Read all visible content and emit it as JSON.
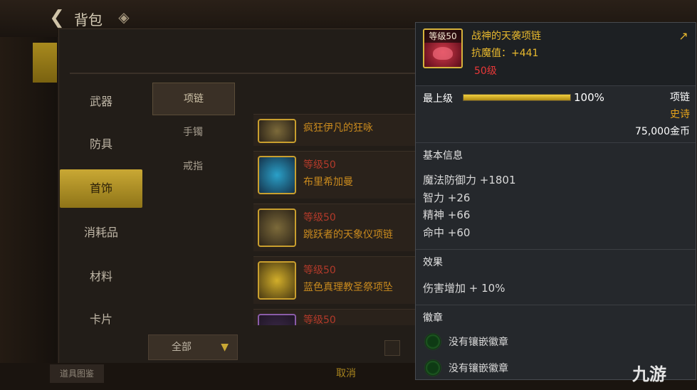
{
  "header": {
    "title": "背包",
    "back_icon": "back-arrow-icon",
    "diamond_icon": "diamond-icon"
  },
  "categories": [
    "武器",
    "防具",
    "首饰",
    "消耗品",
    "材料",
    "卡片"
  ],
  "active_category": "首饰",
  "subcategories": [
    "项链",
    "手镯",
    "戒指"
  ],
  "active_subcategory": "项链",
  "items": [
    {
      "level": "",
      "name": "疯狂伊凡的狂咏"
    },
    {
      "level": "等级50",
      "name": "布里希加曼"
    },
    {
      "level": "等级50",
      "name": "跳跃者的天象仪项链"
    },
    {
      "level": "等级50",
      "name": "蓝色真理教圣祭项坠"
    },
    {
      "level": "等级50",
      "name": ""
    }
  ],
  "filter": {
    "label": "全部",
    "arrow": "▼"
  },
  "bottom": {
    "left_label": "道具图鉴",
    "mid_label": "取消"
  },
  "tooltip": {
    "icon_level": "等级50",
    "name": "战神的天袭项链",
    "resist": "抗魔值：+441",
    "level_req": "50级",
    "grade": "最上级",
    "grade_percent": 100,
    "grade_percent_text": "100%",
    "type": "项链",
    "rarity": "史诗",
    "price": "75,000金币",
    "basic_info_title": "基本信息",
    "stats": [
      "魔法防御力 +1801",
      "智力 +26",
      "精神 +66",
      "命中 +60"
    ],
    "effect_title": "效果",
    "effect": "伤害增加 + 10%",
    "emblem_title": "徽章",
    "emblem_slots": [
      "没有镶嵌徽章",
      "没有镶嵌徽章"
    ]
  },
  "watermark": "九游",
  "colors": {
    "gold": "#e9b92e",
    "epic": "#e9a51a",
    "red": "#e83838"
  }
}
